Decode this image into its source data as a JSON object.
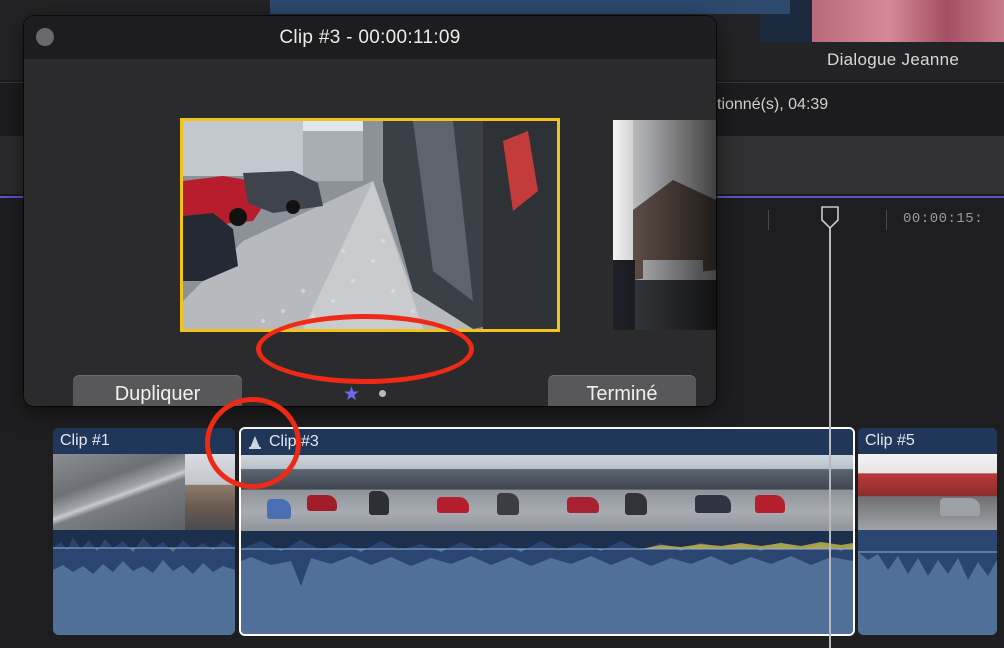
{
  "background": {
    "viewer_title": "Dialogue Jeanne",
    "selection_info": "tionné(s), 04:39",
    "ruler_timecode": "00:00:15:"
  },
  "popover": {
    "title": "Clip #3 - 00:00:11:09",
    "duplicate_label": "Dupliquer",
    "done_label": "Terminé",
    "pages_total": 2,
    "current_page": 1
  },
  "timeline": {
    "clips": [
      {
        "label": "Clip #1",
        "selected": false
      },
      {
        "label": "Clip #3",
        "selected": true,
        "has_audition_icon": true
      },
      {
        "label": "Clip #5",
        "selected": false
      }
    ]
  },
  "colors": {
    "accent_selection": "#f2c419",
    "annotation": "#ee2a16",
    "clip_header": "#20375a",
    "clip_audio": "#506f99",
    "page_indicator": "#6a6af0"
  },
  "icons": {
    "audition": "audition-icon",
    "favorite_page": "star-icon",
    "page": "dot-icon",
    "playhead": "playhead-icon"
  }
}
